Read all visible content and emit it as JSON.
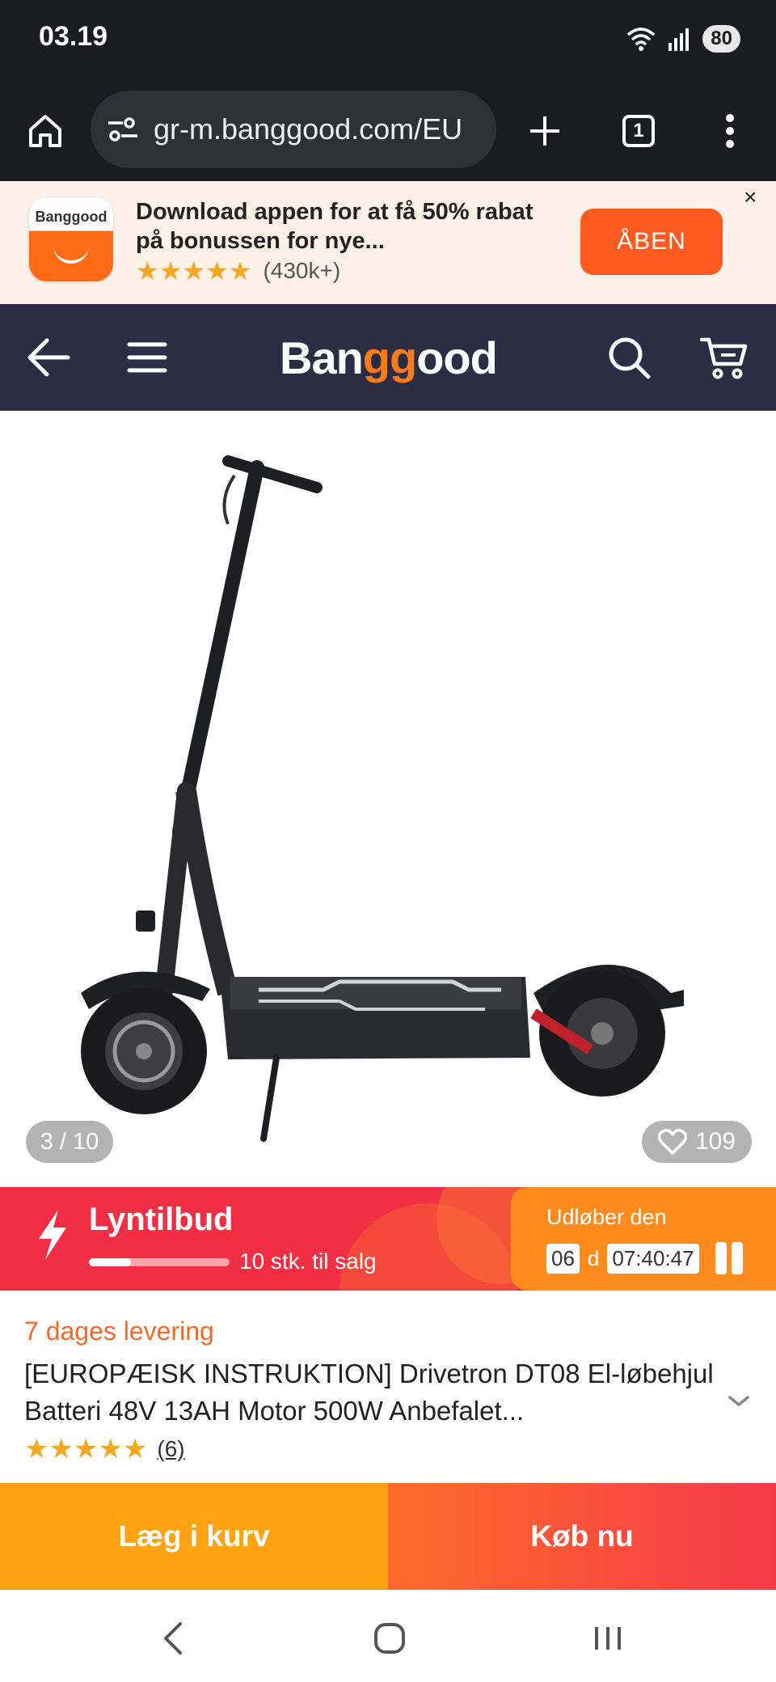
{
  "status_bar": {
    "time": "03.19",
    "battery": "80",
    "wifi_icon": "wifi-icon",
    "signal_icon": "signal-icon"
  },
  "browser": {
    "url": "gr-m.banggood.com/EU",
    "tab_count": "1"
  },
  "app_banner": {
    "logo_text": "Banggood",
    "message": "Download appen for at få 50% rabat på bonussen for nye...",
    "stars": "★★★★★",
    "review_count": "(430k+)",
    "open_button": "ÅBEN",
    "close": "×"
  },
  "site_nav": {
    "brand_pre": "Ban",
    "brand_gg": "gg",
    "brand_post": "ood"
  },
  "product_image": {
    "counter": "3 / 10",
    "wishlist_count": "109"
  },
  "flash_deal": {
    "title": "Lyntilbud",
    "stock": "10 stk. til salg",
    "stock_sold_fraction": 0.3,
    "expires_label": "Udløber den",
    "days": "06",
    "days_unit": "d",
    "time": "07:40:47"
  },
  "product": {
    "delivery": "7 dages levering",
    "title": "[EUROPÆISK INSTRUKTION] Drivetron DT08 El-løbehjul Batteri 48V 13AH Motor 500W Anbefalet...",
    "stars": "★★★★★",
    "reviews": "(6)"
  },
  "actions": {
    "add_to_cart": "Læg i kurv",
    "buy_now": "Køb nu"
  },
  "colors": {
    "accent_orange": "#ff7a1a",
    "flash_red": "#f22e45",
    "cart_yellow": "#ffa312",
    "nav_dark": "#2c2d45"
  }
}
